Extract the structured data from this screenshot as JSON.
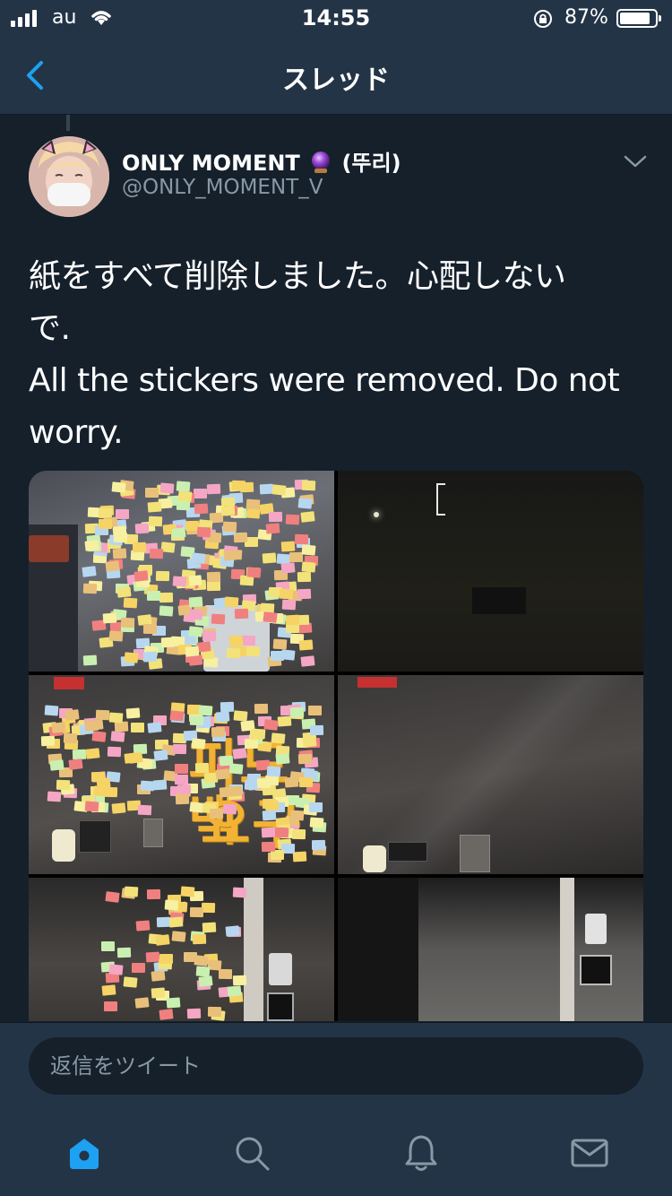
{
  "status_bar": {
    "carrier": "au",
    "time": "14:55",
    "battery_percent": "87%",
    "battery_level": 0.87
  },
  "nav": {
    "title": "スレッド"
  },
  "tweet": {
    "display_name": "ONLY MOMENT",
    "display_name_suffix": "(뚜리)",
    "handle": "@ONLY_MOMENT_V",
    "text_lines": [
      "紙をすべて削除しました。心配しない",
      "で.",
      "All the stickers were removed. Do not",
      "worry."
    ],
    "media_text": {
      "feedback_line1": "피드백",
      "feedback_line2": "요구"
    }
  },
  "reply": {
    "placeholder": "返信をツイート"
  },
  "colors": {
    "background": "#15202b",
    "bar": "#243447",
    "accent": "#1da1f2",
    "secondary_text": "#8899a6"
  },
  "icons": {
    "back": "chevron-left-icon",
    "more": "chevron-down-icon",
    "home": "home-icon",
    "search": "search-icon",
    "notifications": "bell-icon",
    "messages": "mail-icon"
  }
}
